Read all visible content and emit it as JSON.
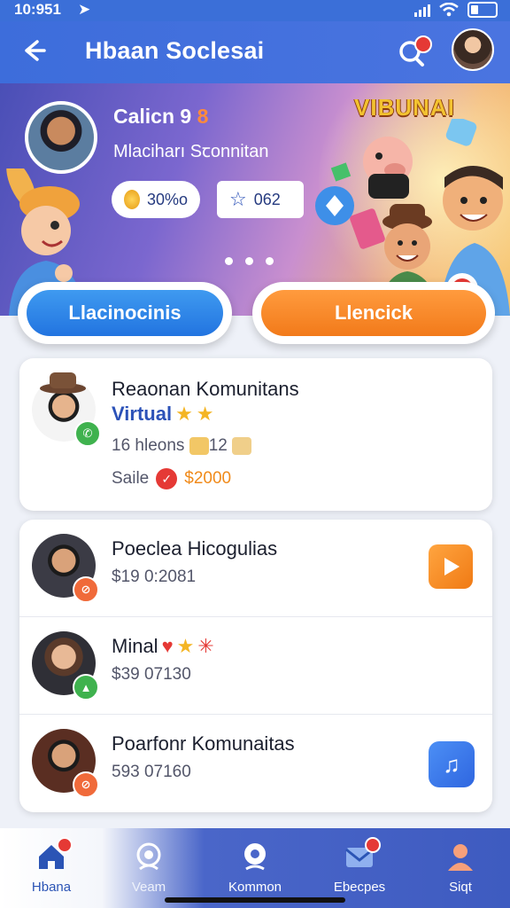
{
  "status": {
    "time": "10:951"
  },
  "appbar": {
    "title": "Hbaan Soclesai"
  },
  "profile": {
    "name_a": "Calicn 9",
    "name_b": "8",
    "subtitle": "Mlaciharı Sꞇonnitan",
    "coins": "30%o",
    "stars": "062",
    "banner_badge": "VIBUNAI"
  },
  "actions": {
    "primary": "Llacinocinis",
    "secondary": "Llencick"
  },
  "featured": {
    "title": "Reaonan Komunitans",
    "tag": "Virtual",
    "meta": "16 hleons",
    "meta_chip": "12",
    "price_label": "Saile",
    "price": "$2000"
  },
  "list": [
    {
      "title": "Poeclea Hicogulias",
      "value": "$19 0:2081"
    },
    {
      "title": "Minal",
      "value": "$39 07130"
    },
    {
      "title": "Poarfonr Komunaitas",
      "value": "593 07160"
    }
  ],
  "nav": [
    {
      "label": "Hbana"
    },
    {
      "label": "Veam"
    },
    {
      "label": "Kommon"
    },
    {
      "label": "Ebecpes"
    },
    {
      "label": "Siqt"
    }
  ],
  "colors": {
    "brand_blue": "#3d6ddb",
    "accent_orange": "#f27a1a",
    "accent_blue": "#2274e0",
    "badge_red": "#e53935"
  }
}
